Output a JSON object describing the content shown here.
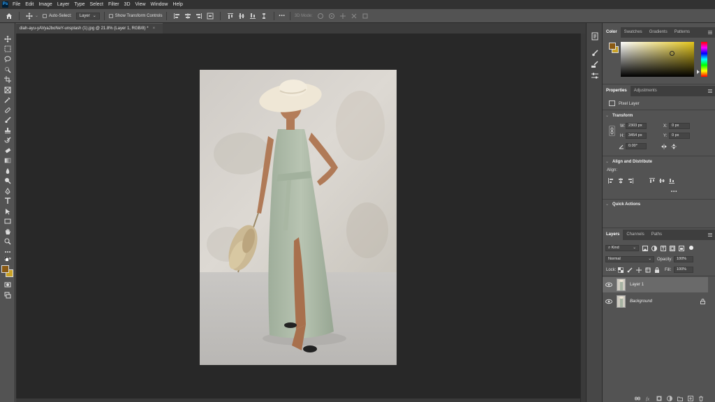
{
  "menu": {
    "app_logo": "Ps",
    "items": [
      "File",
      "Edit",
      "Image",
      "Layer",
      "Type",
      "Select",
      "Filter",
      "3D",
      "View",
      "Window",
      "Help"
    ]
  },
  "options": {
    "auto_select_label": "Auto-Select:",
    "auto_select_target": "Layer",
    "show_transform_label": "Show Transform Controls",
    "mode_3d_label": "3D Mode:",
    "more_label": "•••"
  },
  "document": {
    "tab_title": "diah-ayu-yAVyaJboNeY-unsplash (1).jpg @ 21.8% (Layer 1, RGB/8) *",
    "close_label": "×"
  },
  "color_panel": {
    "tabs": [
      "Color",
      "Swatches",
      "Gradients",
      "Patterns"
    ],
    "foreground": "#8a5a14",
    "background": "#c9a227",
    "field_hue": "#e3c51c"
  },
  "properties_panel": {
    "tabs": [
      "Properties",
      "Adjustments"
    ],
    "layer_type": "Pixel Layer",
    "transform_title": "Transform",
    "w_label": "W:",
    "w_value": "2303 px",
    "h_label": "H:",
    "h_value": "3454 px",
    "x_label": "X:",
    "x_value": "0 px",
    "y_label": "Y:",
    "y_value": "0 px",
    "angle_value": "0.00°",
    "align_title": "Align and Distribute",
    "align_label": "Align:",
    "more_label": "•••",
    "quick_actions_title": "Quick Actions"
  },
  "layers_panel": {
    "tabs": [
      "Layers",
      "Channels",
      "Paths"
    ],
    "filter_kind": "Kind",
    "blend_mode": "Normal",
    "opacity_label": "Opacity:",
    "opacity_value": "100%",
    "lock_label": "Lock:",
    "fill_label": "Fill:",
    "fill_value": "100%",
    "layers": [
      {
        "name": "Layer 1",
        "selected": true,
        "locked": false
      },
      {
        "name": "Background",
        "selected": false,
        "locked": true
      }
    ]
  }
}
